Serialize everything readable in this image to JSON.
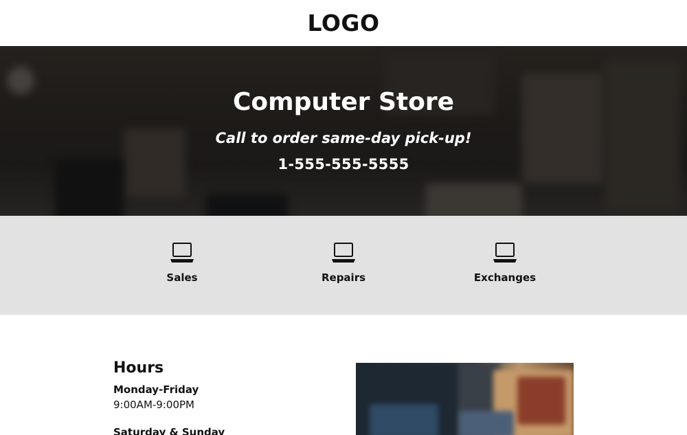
{
  "header": {
    "logo_text": "LOGO"
  },
  "hero": {
    "title": "Computer Store",
    "subtitle": "Call to order same-day pick-up!",
    "phone": "1-555-555-5555"
  },
  "services": [
    {
      "label": "Sales",
      "icon": "laptop-icon"
    },
    {
      "label": "Repairs",
      "icon": "laptop-icon"
    },
    {
      "label": "Exchanges",
      "icon": "laptop-icon"
    }
  ],
  "hours": {
    "title": "Hours",
    "weekday_label": "Monday-Friday",
    "weekday_time": "9:00AM-9:00PM",
    "weekend_label": "Saturday & Sunday"
  },
  "colors": {
    "services_bg": "#e2e2e2",
    "text": "#111111",
    "hero_text": "#ffffff"
  }
}
